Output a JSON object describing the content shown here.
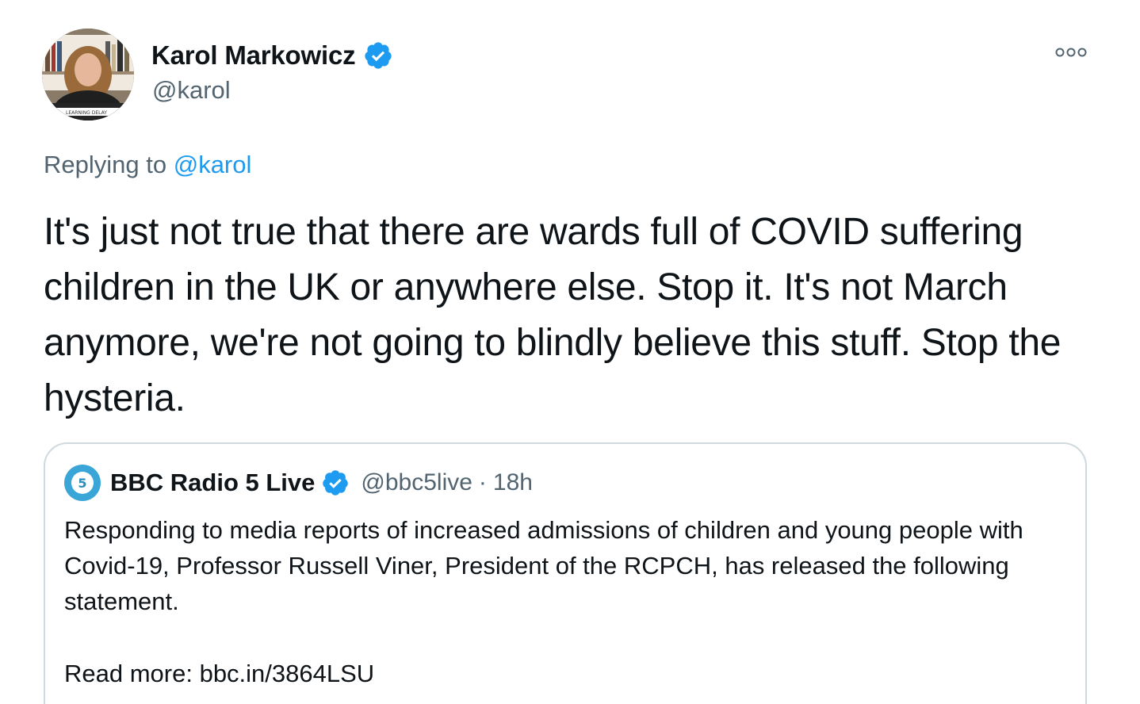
{
  "author": {
    "name": "Karol Markowicz",
    "handle": "@karol",
    "avatar_caption": "LEARNING DELAY"
  },
  "colors": {
    "verified": "#1d9bf0",
    "link": "#1d9bf0",
    "secondary_text": "#536471",
    "border": "#cfd9de"
  },
  "icons": {
    "verified": "verified-badge-icon",
    "more": "more-options-icon"
  },
  "reply": {
    "prefix": "Replying to",
    "to": "@karol"
  },
  "tweet": {
    "text": "It's just not true that there are wards full of COVID suffering children in the UK or anywhere else. Stop it. It's not March anymore, we're not going to blindly believe this stuff. Stop the hysteria."
  },
  "quoted": {
    "avatar_label": "5",
    "name": "BBC Radio 5 Live",
    "handle": "@bbc5live",
    "separator": "·",
    "time": "18h",
    "body": "Responding to media reports of increased admissions of children and young people with Covid-19, Professor Russell Viner, President of the RCPCH, has released the following statement.",
    "read_more": "Read more: bbc.in/3864LSU"
  }
}
